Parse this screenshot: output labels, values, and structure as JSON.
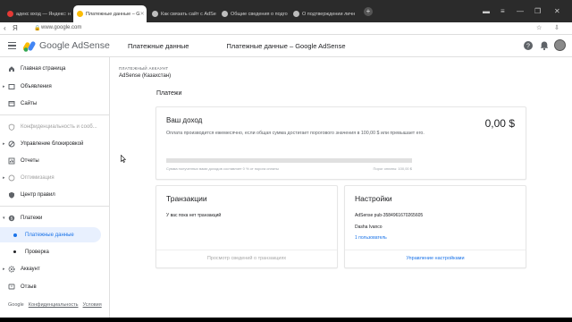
{
  "browser": {
    "tabs": [
      {
        "title": "адекс вход — Яндекс: н",
        "favicon_color": "#e53935",
        "active": false
      },
      {
        "title": "Платежные данные – G",
        "favicon_color": "#fbbc04",
        "active": true
      },
      {
        "title": "Как связать сайт с AdSe",
        "favicon_color": "#bdbdbd",
        "active": false
      },
      {
        "title": "Общие сведения о подго",
        "favicon_color": "#bdbdbd",
        "active": false
      },
      {
        "title": "О подтверждении личн",
        "favicon_color": "#bdbdbd",
        "active": false
      }
    ],
    "new_tab": "+",
    "url": "www.google.com",
    "page_title": "Платежные данные – Google AdSense"
  },
  "header": {
    "brand": "Google AdSense",
    "section": "Платежные данные"
  },
  "sidebar": {
    "items": [
      {
        "label": "Главная страница",
        "icon": "home-icon",
        "caret": false,
        "disabled": false
      },
      {
        "label": "Объявления",
        "icon": "ads-icon",
        "caret": true,
        "disabled": false
      },
      {
        "label": "Сайты",
        "icon": "sites-icon",
        "caret": false,
        "disabled": false
      },
      {
        "label": "Конфиденциальность и сооб...",
        "icon": "privacy-icon",
        "caret": false,
        "disabled": true
      },
      {
        "label": "Управление блокировкой",
        "icon": "block-icon",
        "caret": true,
        "disabled": false
      },
      {
        "label": "Отчеты",
        "icon": "reports-icon",
        "caret": false,
        "disabled": false
      },
      {
        "label": "Оптимизация",
        "icon": "optimization-icon",
        "caret": true,
        "disabled": true
      },
      {
        "label": "Центр правил",
        "icon": "policy-icon",
        "caret": false,
        "disabled": false
      },
      {
        "label": "Платежи",
        "icon": "payments-icon",
        "caret": true,
        "disabled": false
      },
      {
        "label": "Платежные данные",
        "icon": "",
        "sub": true,
        "selected": true
      },
      {
        "label": "Проверка",
        "icon": "",
        "sub": true,
        "selected": false
      },
      {
        "label": "Аккаунт",
        "icon": "account-icon",
        "caret": true,
        "disabled": false
      },
      {
        "label": "Отзыв",
        "icon": "feedback-icon",
        "caret": false,
        "disabled": false
      }
    ],
    "footer": {
      "google": "Google",
      "privacy": "Конфиденциальность",
      "terms": "Условия"
    }
  },
  "main": {
    "account_label": "ПЛАТЕЖНЫЙ АККАУНТ",
    "account_name": "AdSense (Казахстан)",
    "payments_heading": "Платежи",
    "income": {
      "title": "Ваш доход",
      "amount": "0,00 $",
      "description": "Оплата производится ежемесячно, если общая сумма достигает порогового значения в 100,00 $ или превышает его.",
      "progress_percent": 0,
      "progress_left": "Сумма полученных вами доходов составляет 0 % от порога оплаты",
      "progress_right": "Порог оплаты: 100,00 $"
    },
    "transactions": {
      "title": "Транзакции",
      "empty_text": "У вас пока нет транзакций",
      "footer_link": "Просмотр сведений о транзакциях"
    },
    "settings": {
      "title": "Настройки",
      "publisher_id": "AdSense pub-3584961670265605",
      "user_name": "Dasha Ivanco",
      "users_link": "1 пользователь",
      "footer_link": "Управление настройками"
    }
  }
}
